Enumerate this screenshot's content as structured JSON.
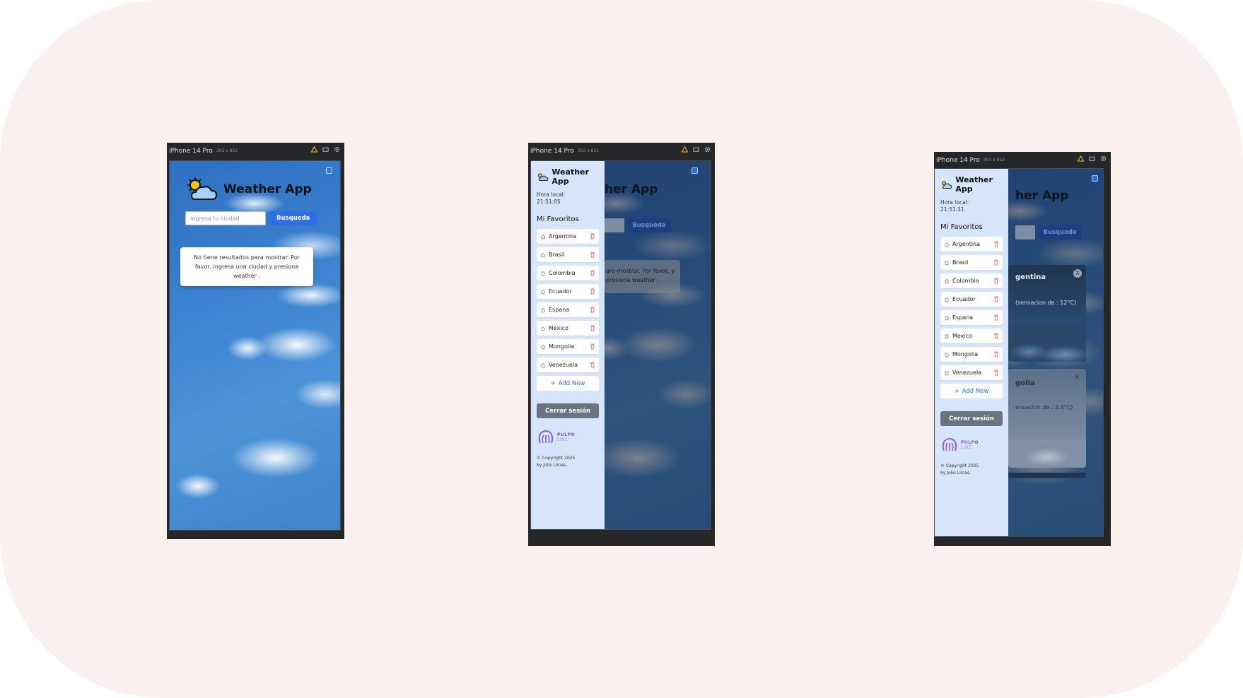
{
  "device": {
    "name": "iPhone 14 Pro",
    "size_label": "393 x 852"
  },
  "app": {
    "title": "Weather App",
    "search_placeholder": "Ingresa tu ciudad",
    "search_button": "Busqueda",
    "empty_message": "No tiene resultados para mostrar. Por favor, ingresa una ciudad y presiona weather .",
    "empty_message_partial": "ara mostrar. Por favor, y presiona weather ."
  },
  "drawer": {
    "title": "Weather App",
    "local_time_label": "Hora local:",
    "favorites_title": "Mi Favoritos",
    "favorites": [
      "Argentina",
      "Brasil",
      "Colombia",
      "Ecuador",
      "Espana",
      "Mexico",
      "Mongolia",
      "Venezuela"
    ],
    "add_new": "Add New",
    "logout": "Cerrar sesión",
    "brand_top": "PULPO",
    "brand_bottom": "LINE",
    "copyright_line1": "© Copyright 2025",
    "copyright_line2": "by Julio Llinas."
  },
  "panels": {
    "p2": {
      "local_time": "21:51:05",
      "title_partial": "her App"
    },
    "p3": {
      "local_time": "21:51:31",
      "title_partial": "her App",
      "card1_title": "gentina",
      "card1_sub": "(sensacion de : 12°C)",
      "card2_title": "golia",
      "card2_sub": "ensacion de : 3.4°C)",
      "close_label": "X"
    }
  },
  "colors": {
    "accent": "#2f6fe6",
    "drawer_bg": "#d6e5fb",
    "logout_bg": "#6b7280",
    "delete_icon": "#e05a5a",
    "page_bg": "#faf1ef"
  }
}
